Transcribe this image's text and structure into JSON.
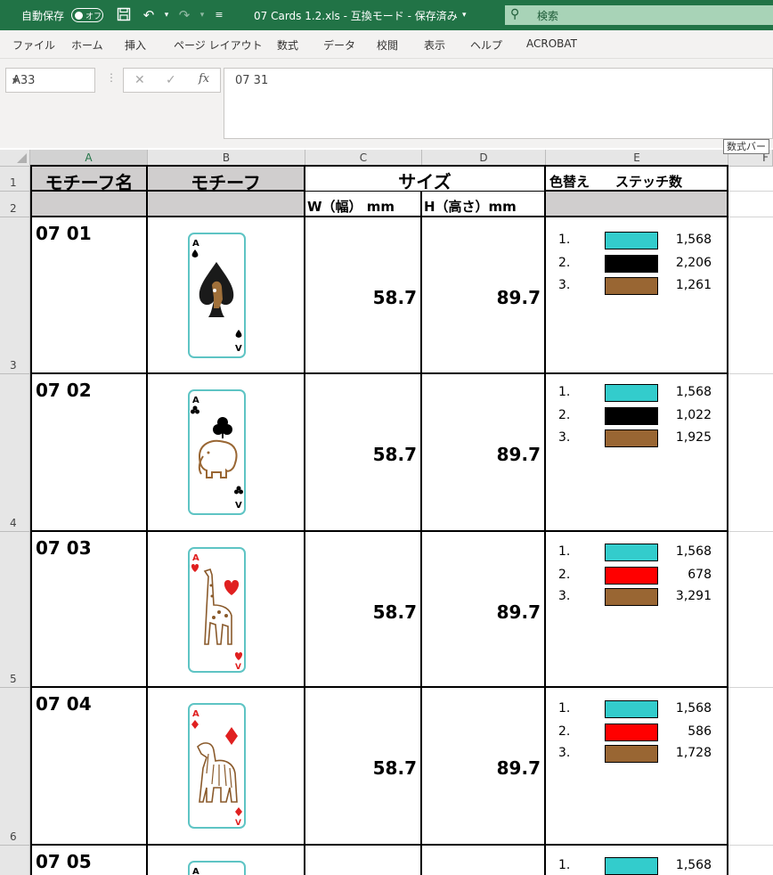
{
  "titlebar": {
    "autosave_label": "自動保存",
    "autosave_state": "オフ",
    "title": "07 Cards 1.2.xls  -  互換モード - 保存済み",
    "search_placeholder": "検索"
  },
  "ribbon": {
    "tabs": [
      "ファイル",
      "ホーム",
      "挿入",
      "ページ レイアウト",
      "数式",
      "データ",
      "校閲",
      "表示",
      "ヘルプ",
      "ACROBAT"
    ]
  },
  "formula_bar": {
    "name_box": "A33",
    "formula": "07 31",
    "tooltip": "数式バー"
  },
  "columns": [
    "A",
    "B",
    "C",
    "D",
    "E",
    "F"
  ],
  "header": {
    "motif_name": "モチーフ名",
    "motif": "モチーフ",
    "size": "サイズ",
    "color_change": "色替え",
    "stitch_count": "ステッチ数",
    "width_label": "W（幅） mm",
    "height_label": "H（高さ）mm"
  },
  "row_numbers": [
    "1",
    "2",
    "3",
    "4",
    "5",
    "6"
  ],
  "motifs": [
    {
      "name": "07 01",
      "width": "58.7",
      "height": "89.7",
      "suit": "spade",
      "figure": "horse",
      "colors": [
        {
          "index": "1.",
          "color": "#33cccc",
          "stitches": "1,568"
        },
        {
          "index": "2.",
          "color": "#000000",
          "stitches": "2,206"
        },
        {
          "index": "3.",
          "color": "#996633",
          "stitches": "1,261"
        }
      ]
    },
    {
      "name": "07 02",
      "width": "58.7",
      "height": "89.7",
      "suit": "club",
      "figure": "elephant",
      "colors": [
        {
          "index": "1.",
          "color": "#33cccc",
          "stitches": "1,568"
        },
        {
          "index": "2.",
          "color": "#000000",
          "stitches": "1,022"
        },
        {
          "index": "3.",
          "color": "#996633",
          "stitches": "1,925"
        }
      ]
    },
    {
      "name": "07 03",
      "width": "58.7",
      "height": "89.7",
      "suit": "heart",
      "figure": "giraffe",
      "colors": [
        {
          "index": "1.",
          "color": "#33cccc",
          "stitches": "1,568"
        },
        {
          "index": "2.",
          "color": "#ff0000",
          "stitches": "678"
        },
        {
          "index": "3.",
          "color": "#996633",
          "stitches": "3,291"
        }
      ]
    },
    {
      "name": "07 04",
      "width": "58.7",
      "height": "89.7",
      "suit": "diamond",
      "figure": "afghan-hound",
      "colors": [
        {
          "index": "1.",
          "color": "#33cccc",
          "stitches": "1,568"
        },
        {
          "index": "2.",
          "color": "#ff0000",
          "stitches": "586"
        },
        {
          "index": "3.",
          "color": "#996633",
          "stitches": "1,728"
        }
      ]
    },
    {
      "name": "07 05",
      "colors": [
        {
          "index": "1.",
          "color": "#33cccc",
          "stitches": "1,568"
        }
      ]
    }
  ]
}
